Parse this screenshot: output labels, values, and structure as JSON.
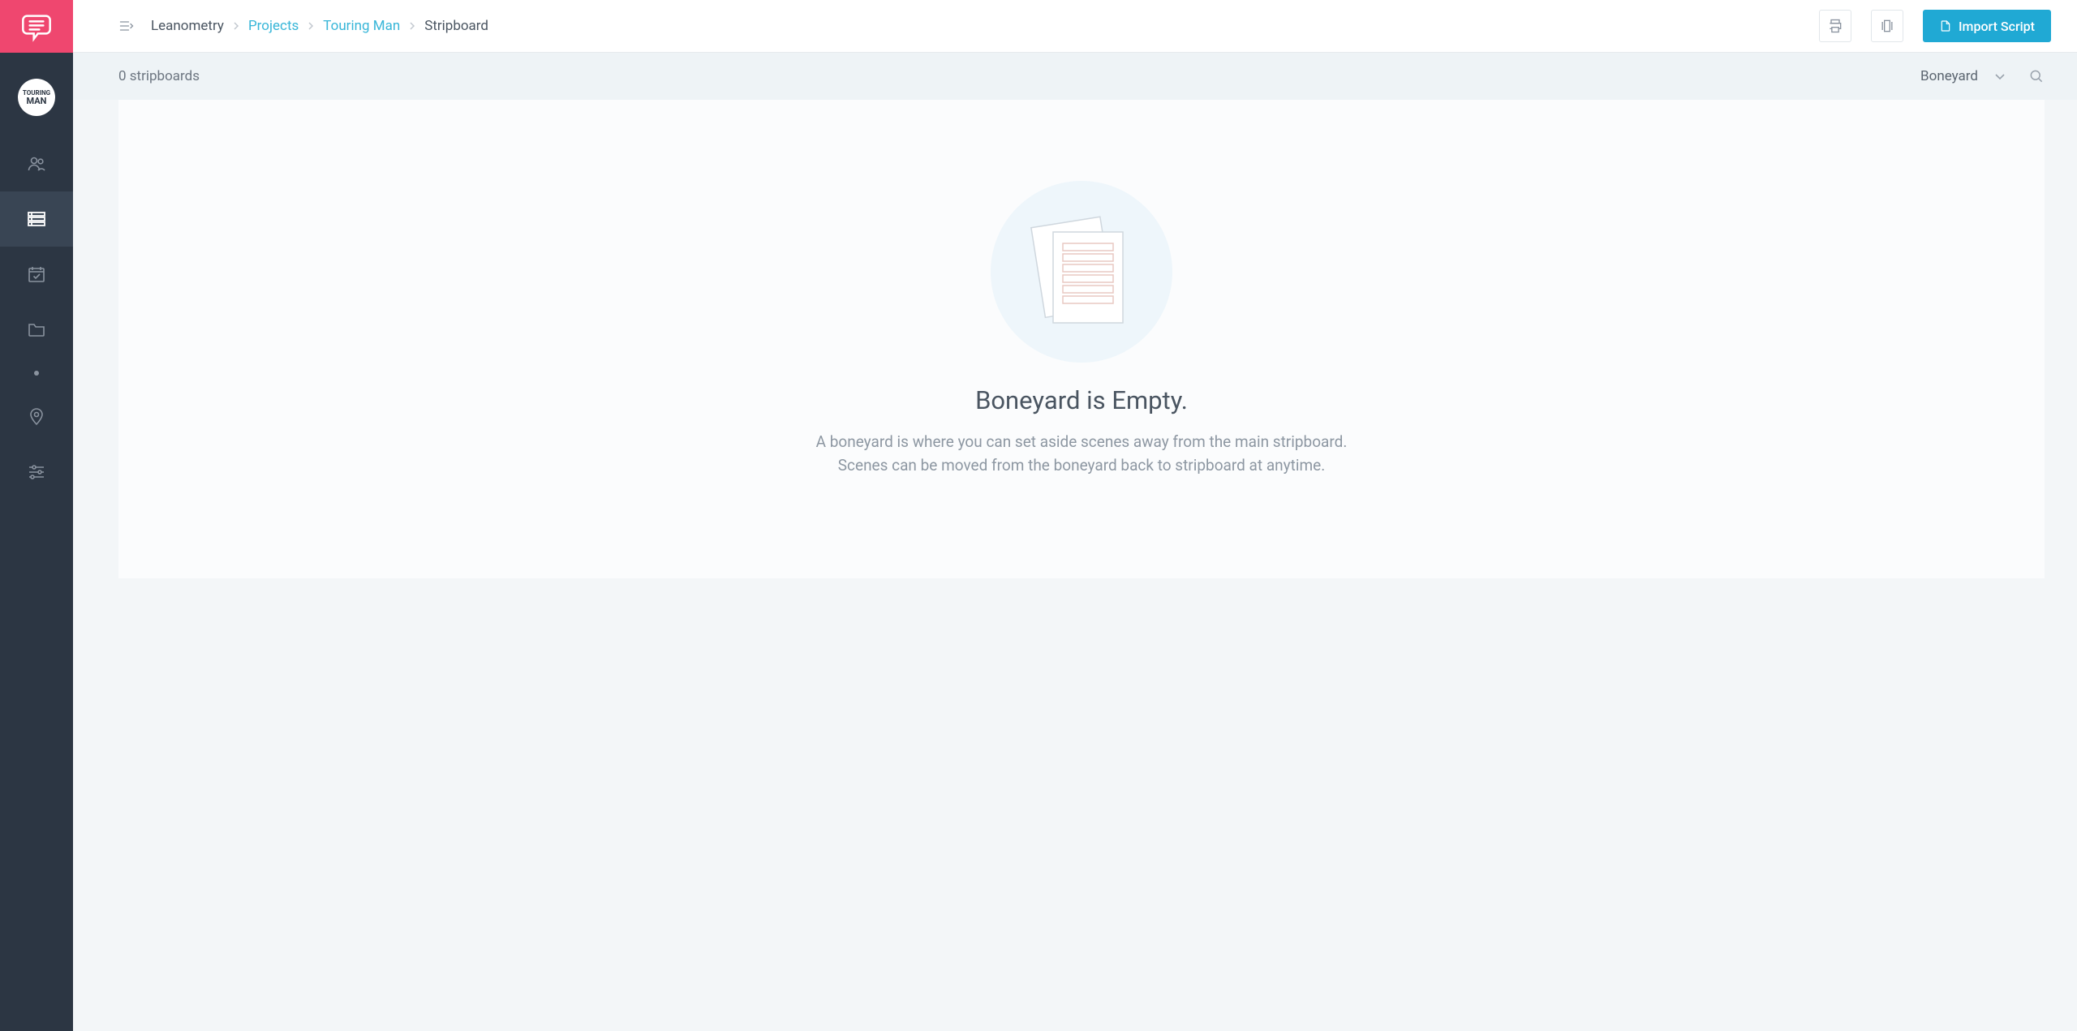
{
  "project_avatar": {
    "line1": "TOURING",
    "line2": "MAN"
  },
  "breadcrumb": {
    "company": "Leanometry",
    "items": [
      {
        "label": "Projects"
      },
      {
        "label": "Touring Man"
      }
    ],
    "current": "Stripboard"
  },
  "topbar": {
    "import_label": "Import Script"
  },
  "subbar": {
    "count_label": "0 stripboards",
    "dropdown_selected": "Boneyard"
  },
  "empty_state": {
    "title": "Boneyard is Empty.",
    "line1": "A boneyard is where you can set aside scenes away from the main stripboard.",
    "line2": "Scenes can be moved from the boneyard back to stripboard at anytime."
  }
}
